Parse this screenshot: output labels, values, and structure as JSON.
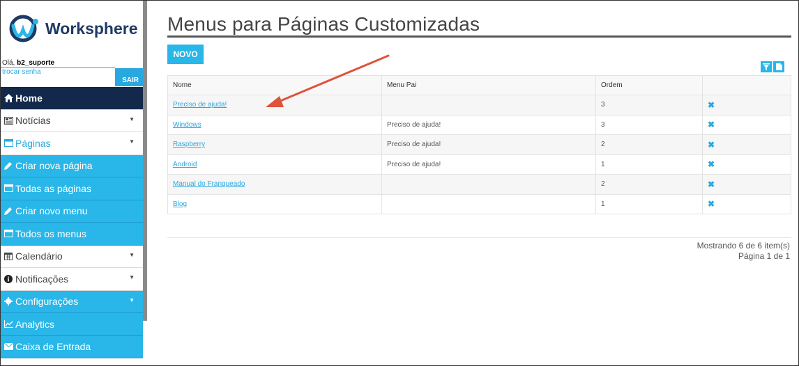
{
  "brand": {
    "name": "Worksphere"
  },
  "user": {
    "greeting_prefix": "Olá, ",
    "username": "b2_suporte",
    "change_password": "trocar senha",
    "logout": "SAIR"
  },
  "sidebar": {
    "items": [
      {
        "label": "Home",
        "icon": "home-icon"
      },
      {
        "label": "Notícias",
        "icon": "newspaper-icon"
      },
      {
        "label": "Páginas",
        "icon": "window-icon"
      },
      {
        "label": "Criar nova página",
        "icon": "pencil-icon"
      },
      {
        "label": "Todas as páginas",
        "icon": "window-icon"
      },
      {
        "label": "Criar novo menu",
        "icon": "pencil-icon"
      },
      {
        "label": "Todos os menus",
        "icon": "window-icon"
      },
      {
        "label": "Calendário",
        "icon": "calendar-icon"
      },
      {
        "label": "Notificações",
        "icon": "info-icon"
      },
      {
        "label": "Configurações",
        "icon": "gear-icon"
      },
      {
        "label": "Analytics",
        "icon": "chart-icon"
      },
      {
        "label": "Caixa de Entrada",
        "icon": "envelope-icon"
      }
    ]
  },
  "main": {
    "title": "Menus para Páginas Customizadas",
    "new_button": "NOVO",
    "table": {
      "headers": [
        "Nome",
        "Menu Pai",
        "Ordem",
        ""
      ],
      "rows": [
        {
          "nome": "Preciso de ajuda!",
          "pai": "",
          "ordem": "3"
        },
        {
          "nome": "Windows",
          "pai": "Preciso de ajuda!",
          "ordem": "3"
        },
        {
          "nome": "Raspberry",
          "pai": "Preciso de ajuda!",
          "ordem": "2"
        },
        {
          "nome": "Android",
          "pai": "Preciso de ajuda!",
          "ordem": "1"
        },
        {
          "nome": "Manual do Franqueado",
          "pai": "",
          "ordem": "2"
        },
        {
          "nome": "Blog",
          "pai": "",
          "ordem": "1"
        }
      ]
    },
    "pagination": {
      "showing": "Mostrando 6 de 6 item(s)",
      "page": "Página 1 de 1"
    }
  },
  "colors": {
    "accent": "#29b6e8",
    "navy": "#13294b",
    "annotation_arrow": "#e0523a"
  }
}
